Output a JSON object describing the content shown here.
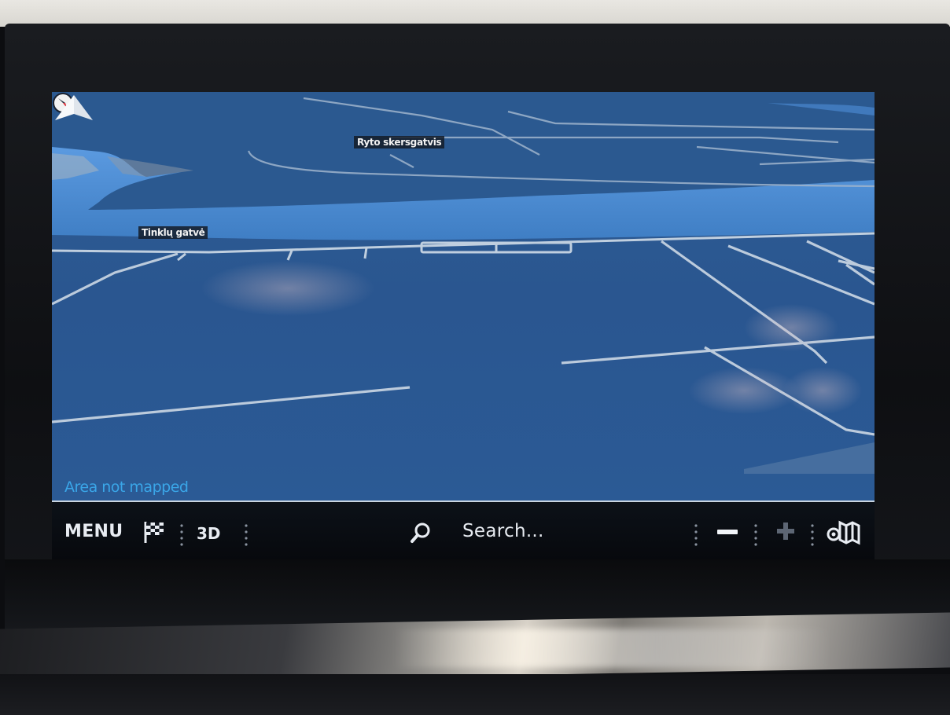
{
  "map": {
    "street_labels": [
      "Ryto skersgatvis",
      "Tinklų gatvė"
    ],
    "status_text": "Area not mapped"
  },
  "toolbar": {
    "menu_label": "MENU",
    "view_mode_label": "3D",
    "search_placeholder": "Search..."
  },
  "icons": {
    "compass": "compass-icon",
    "destination": "checkered-flag-icon",
    "search": "magnifier-icon",
    "zoom_out": "minus-icon",
    "zoom_in": "plus-icon",
    "layers": "map-layers-icon",
    "position": "navigation-arrow-icon"
  },
  "colors": {
    "map_land": "#2d5a92",
    "map_water": "#4f90d6",
    "roads": "#b7c8db",
    "status_text": "#3aa6e8"
  }
}
